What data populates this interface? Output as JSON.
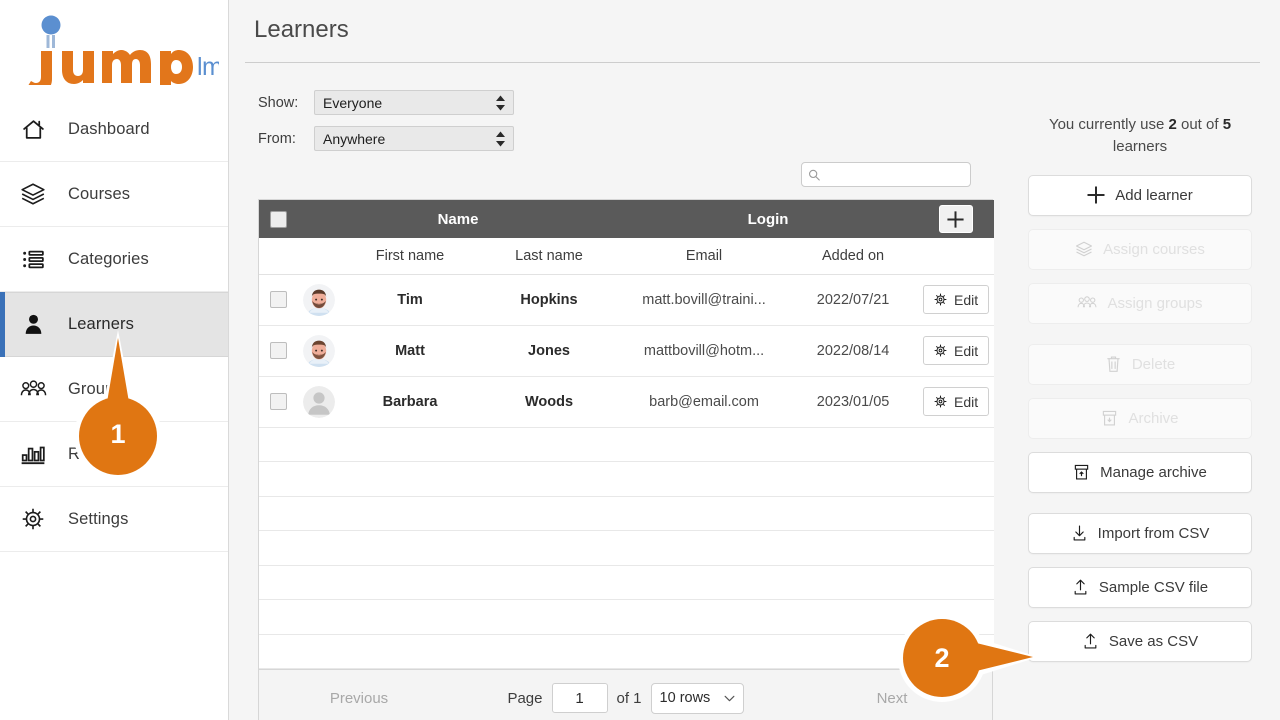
{
  "brand": {
    "name_jump": "jump",
    "name_lms": "lms",
    "orange": "#e2761b",
    "blue": "#5b8fd0"
  },
  "sidebar": {
    "items": [
      {
        "label": "Dashboard",
        "icon": "home-icon",
        "active": false
      },
      {
        "label": "Courses",
        "icon": "books-icon",
        "active": false
      },
      {
        "label": "Categories",
        "icon": "list-icon",
        "active": false
      },
      {
        "label": "Learners",
        "icon": "person-icon",
        "active": true
      },
      {
        "label": "Groups",
        "icon": "people-icon",
        "active": false
      },
      {
        "label": "Reports",
        "icon": "bar-chart-icon",
        "active": false
      },
      {
        "label": "Settings",
        "icon": "gear-icon",
        "active": false
      }
    ]
  },
  "header": {
    "title": "Learners"
  },
  "filters": {
    "show": {
      "label": "Show:",
      "value": "Everyone"
    },
    "from": {
      "label": "From:",
      "value": "Anywhere"
    }
  },
  "search": {
    "value": "",
    "placeholder": ""
  },
  "table": {
    "group_headers": {
      "name": "Name",
      "login": "Login"
    },
    "sub_headers": [
      "First name",
      "Last name",
      "Email",
      "Added on"
    ],
    "rows": [
      {
        "first_name": "Tim",
        "last_name": "Hopkins",
        "email": "matt.bovill@traini...",
        "added_on": "2022/07/21",
        "edit_label": "Edit",
        "avatar": "man-beard-avatar"
      },
      {
        "first_name": "Matt",
        "last_name": "Jones",
        "email": "mattbovill@hotm...",
        "added_on": "2022/08/14",
        "edit_label": "Edit",
        "avatar": "man-beard-avatar"
      },
      {
        "first_name": "Barbara",
        "last_name": "Woods",
        "email": "barb@email.com",
        "added_on": "2023/01/05",
        "edit_label": "Edit",
        "avatar": "placeholder-avatar"
      }
    ],
    "empty_row_count": 7
  },
  "pagination": {
    "previous": "Previous",
    "page_label": "Page",
    "page_value": "1",
    "of_label": "of 1",
    "rows_per_page": "10 rows",
    "next": "Next"
  },
  "right_panel": {
    "quota_prefix": "You currently use",
    "quota_used": "2",
    "quota_middle": "out of",
    "quota_total": "5",
    "quota_suffix": "learners",
    "buttons": [
      {
        "label": "Add learner",
        "icon": "plus-icon",
        "disabled": false,
        "gap_top": false
      },
      {
        "label": "Assign courses",
        "icon": "books-icon",
        "disabled": true,
        "gap_top": false
      },
      {
        "label": "Assign groups",
        "icon": "people-icon",
        "disabled": true,
        "gap_top": false
      },
      {
        "label": "Delete",
        "icon": "trash-icon",
        "disabled": true,
        "gap_top": true
      },
      {
        "label": "Archive",
        "icon": "archive-icon",
        "disabled": true,
        "gap_top": false
      },
      {
        "label": "Manage archive",
        "icon": "archive-up-icon",
        "disabled": false,
        "gap_top": false
      },
      {
        "label": "Import from CSV",
        "icon": "download-icon",
        "disabled": false,
        "gap_top": true
      },
      {
        "label": "Sample CSV file",
        "icon": "upload-icon",
        "disabled": false,
        "gap_top": false
      },
      {
        "label": "Save as CSV",
        "icon": "upload-icon",
        "disabled": false,
        "gap_top": false
      }
    ]
  },
  "callouts": [
    {
      "number": "1",
      "direction": "up",
      "color": "#e07612"
    },
    {
      "number": "2",
      "direction": "right",
      "color": "#e07612"
    }
  ]
}
